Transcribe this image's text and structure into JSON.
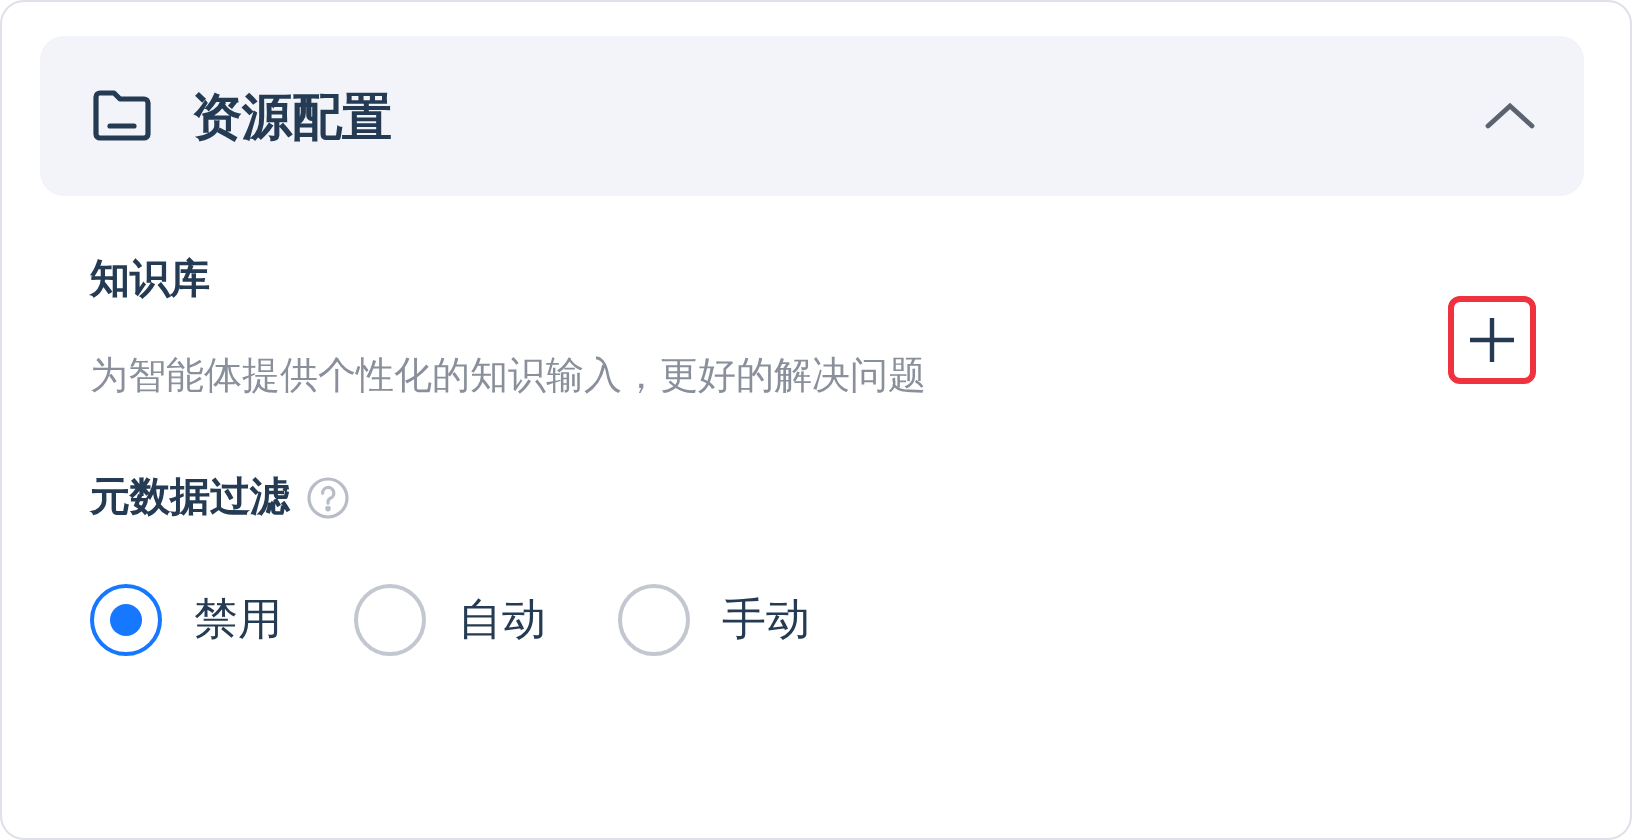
{
  "section": {
    "title": "资源配置",
    "expanded": true
  },
  "knowledge_base": {
    "title": "知识库",
    "description": "为智能体提供个性化的知识输入，更好的解决问题",
    "add_button": {
      "highlighted": true
    }
  },
  "metadata_filter": {
    "title": "元数据过滤",
    "options": [
      {
        "label": "禁用",
        "selected": true
      },
      {
        "label": "自动",
        "selected": false
      },
      {
        "label": "手动",
        "selected": false
      }
    ]
  }
}
